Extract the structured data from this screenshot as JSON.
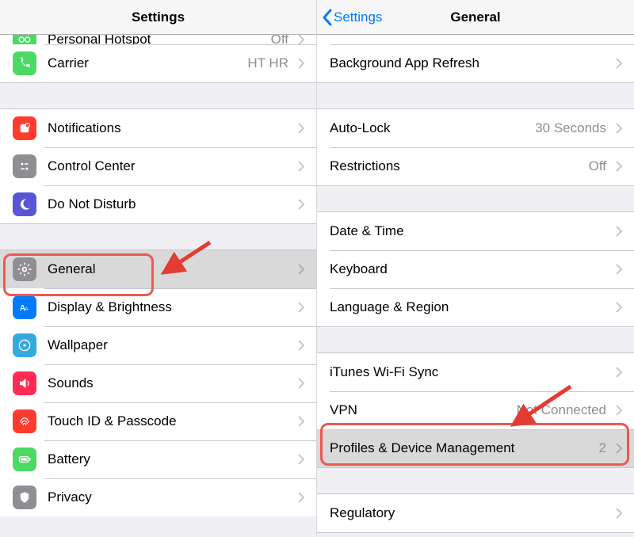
{
  "left": {
    "title": "Settings",
    "hotspot_row": {
      "label": "Personal Hotspot",
      "value": "Off"
    },
    "carrier_row": {
      "label": "Carrier",
      "value": "HT HR"
    },
    "group2": [
      {
        "label": "Notifications"
      },
      {
        "label": "Control Center"
      },
      {
        "label": "Do Not Disturb"
      }
    ],
    "group3": [
      {
        "label": "General"
      },
      {
        "label": "Display & Brightness"
      },
      {
        "label": "Wallpaper"
      },
      {
        "label": "Sounds"
      },
      {
        "label": "Touch ID & Passcode"
      },
      {
        "label": "Battery"
      },
      {
        "label": "Privacy"
      }
    ]
  },
  "right": {
    "back": "Settings",
    "title": "General",
    "group0": [
      {
        "label": "Background App Refresh"
      }
    ],
    "group1": [
      {
        "label": "Auto-Lock",
        "value": "30 Seconds"
      },
      {
        "label": "Restrictions",
        "value": "Off"
      }
    ],
    "group2": [
      {
        "label": "Date & Time"
      },
      {
        "label": "Keyboard"
      },
      {
        "label": "Language & Region"
      }
    ],
    "group3": [
      {
        "label": "iTunes Wi-Fi Sync"
      },
      {
        "label": "VPN",
        "value": "Not Connected"
      },
      {
        "label": "Profiles & Device Management",
        "value": "2"
      }
    ],
    "group4": [
      {
        "label": "Regulatory"
      }
    ]
  }
}
